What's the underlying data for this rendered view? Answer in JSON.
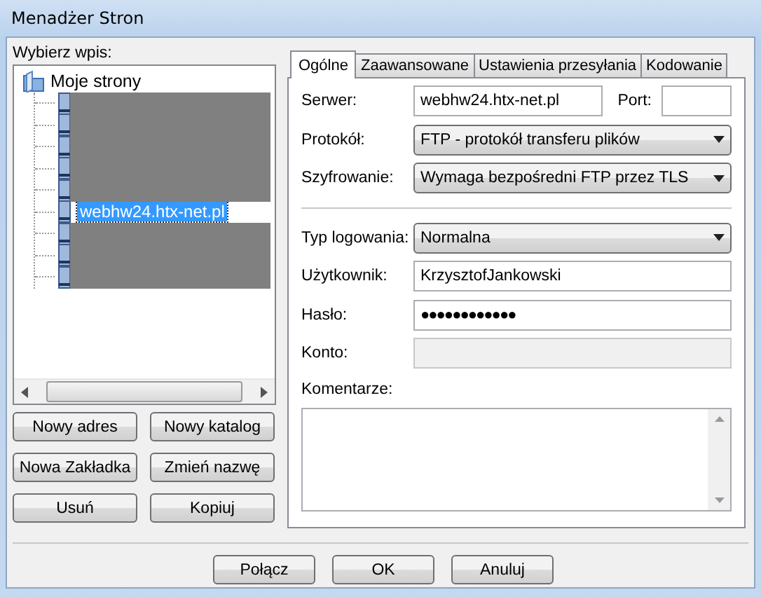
{
  "window": {
    "title": "Menadżer Stron"
  },
  "site_list": {
    "label": "Wybierz wpis:",
    "root": {
      "label": "Moje strony",
      "children": [
        {
          "selected": false
        },
        {
          "selected": false
        },
        {
          "selected": false
        },
        {
          "selected": false
        },
        {
          "selected": false
        },
        {
          "label": "webhw24.htx-net.pl",
          "selected": true
        },
        {
          "selected": false
        },
        {
          "selected": false
        },
        {
          "selected": false
        }
      ]
    }
  },
  "left_buttons": [
    "Nowy adres",
    "Nowy katalog",
    "Nowa Zakładka",
    "Zmień nazwę",
    "Usuń",
    "Kopiuj"
  ],
  "tabs": [
    {
      "label": "Ogólne",
      "selected": true
    },
    {
      "label": "Zaawansowane",
      "selected": false
    },
    {
      "label": "Ustawienia przesyłania",
      "selected": false
    },
    {
      "label": "Kodowanie",
      "selected": false
    }
  ],
  "general": {
    "server": {
      "label": "Serwer:",
      "value": "webhw24.htx-net.pl"
    },
    "port": {
      "label": "Port:"
    },
    "protocol": {
      "label": "Protokół:",
      "value": "FTP - protokół transferu plików"
    },
    "encryption": {
      "label": "Szyfrowanie:",
      "value": "Wymaga bezpośredni FTP przez TLS"
    },
    "logon_type": {
      "label": "Typ logowania:",
      "value": "Normalna"
    },
    "user": {
      "label": "Użytkownik:",
      "value": "KrzysztofJankowski"
    },
    "password": {
      "label": "Hasło:",
      "value": "●●●●●●●●●●●●"
    },
    "account": {
      "label": "Konto:",
      "disabled": true
    },
    "comments": {
      "label": "Komentarze:"
    }
  },
  "bottom_buttons": [
    "Połącz",
    "OK",
    "Anuluj"
  ]
}
